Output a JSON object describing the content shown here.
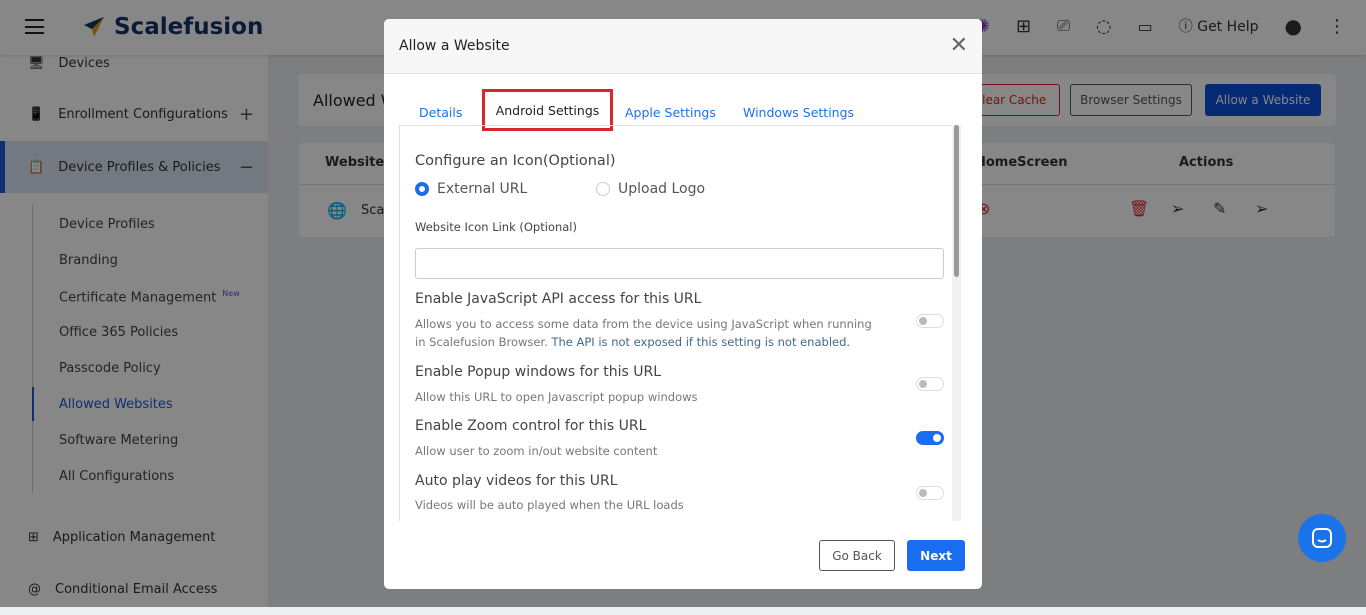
{
  "header": {
    "brand": "Scalefusion",
    "get_help": "Get Help"
  },
  "sidebar": {
    "items": [
      {
        "label": "Devices"
      },
      {
        "label": "Enrollment Configurations"
      },
      {
        "label": "Device Profiles & Policies"
      },
      {
        "label": "Application Management"
      },
      {
        "label": "Conditional Email Access"
      }
    ],
    "sub_items": [
      {
        "label": "Device Profiles"
      },
      {
        "label": "Branding"
      },
      {
        "label": "Certificate Management",
        "badge": "New"
      },
      {
        "label": "Office 365 Policies"
      },
      {
        "label": "Passcode Policy"
      },
      {
        "label": "Allowed Websites"
      },
      {
        "label": "Software Metering"
      },
      {
        "label": "All Configurations"
      }
    ]
  },
  "main": {
    "title": "Allowed Websites",
    "clear_cache": "Clear Cache",
    "browser_settings": "Browser Settings",
    "allow_website": "Allow a Website",
    "table": {
      "headers": [
        "Website",
        "HomeScreen",
        "Actions"
      ],
      "rows": [
        {
          "website": "Scalefusion"
        }
      ]
    }
  },
  "modal": {
    "title": "Allow a Website",
    "tabs": [
      "Details",
      "Android Settings",
      "Apple Settings",
      "Windows Settings"
    ],
    "active_tab": "Android Settings",
    "icon_section": "Configure an Icon(Optional)",
    "radio_options": [
      "External URL",
      "Upload Logo"
    ],
    "radio_selected": "External URL",
    "icon_link_label": "Website Icon Link (Optional)",
    "icon_link_value": "",
    "settings": [
      {
        "title": "Enable JavaScript API access for this URL",
        "desc": "Allows you to access some data from the device using JavaScript when running in Scalefusion Browser.",
        "desc_note": "The API is not exposed if this setting is not enabled.",
        "enabled": false
      },
      {
        "title": "Enable Popup windows for this URL",
        "desc": "Allow this URL to open Javascript popup windows",
        "enabled": false
      },
      {
        "title": "Enable Zoom control for this URL",
        "desc": "Allow user to zoom in/out website content",
        "enabled": true
      },
      {
        "title": "Auto play videos for this URL",
        "desc": "Videos will be auto played when the URL loads",
        "enabled": false
      }
    ],
    "go_back": "Go Back",
    "next": "Next"
  },
  "colors": {
    "accent": "#1a6cf0",
    "brand": "#14336b",
    "danger": "#d9262b"
  }
}
